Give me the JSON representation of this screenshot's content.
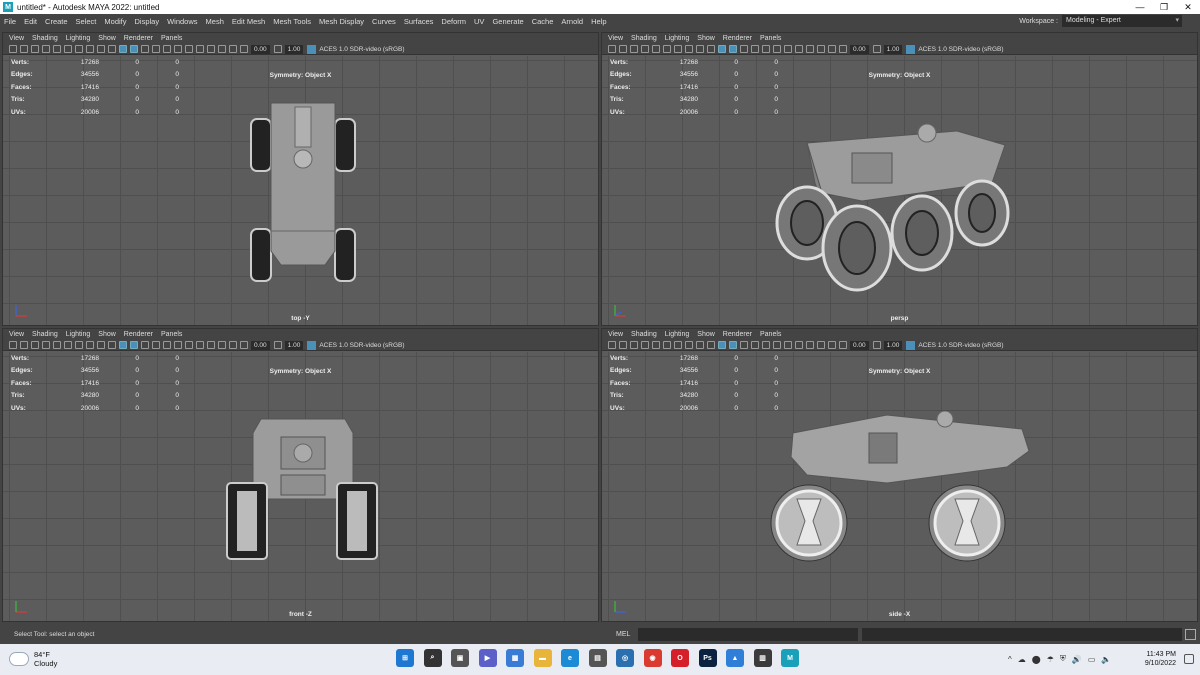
{
  "window": {
    "title": "untitled* - Autodesk MAYA 2022: untitled",
    "logo": "M",
    "controls": [
      "—",
      "❐",
      "✕"
    ]
  },
  "menu": [
    "File",
    "Edit",
    "Create",
    "Select",
    "Modify",
    "Display",
    "Windows",
    "Mesh",
    "Edit Mesh",
    "Mesh Tools",
    "Mesh Display",
    "Curves",
    "Surfaces",
    "Deform",
    "UV",
    "Generate",
    "Cache",
    "Arnold",
    "Help"
  ],
  "workspace": {
    "label": "Workspace :",
    "value": "Modeling - Expert"
  },
  "panel_menu": [
    "View",
    "Shading",
    "Lighting",
    "Show",
    "Renderer",
    "Panels"
  ],
  "toolbar": {
    "val1": "0.00",
    "val2": "1.00",
    "colorspace": "ACES 1.0 SDR-video (sRGB)"
  },
  "hud": {
    "rows": [
      {
        "k": "Verts:",
        "v": "17268",
        "a": "0",
        "b": "0"
      },
      {
        "k": "Edges:",
        "v": "34556",
        "a": "0",
        "b": "0"
      },
      {
        "k": "Faces:",
        "v": "17416",
        "a": "0",
        "b": "0"
      },
      {
        "k": "Tris:",
        "v": "34280",
        "a": "0",
        "b": "0"
      },
      {
        "k": "UVs:",
        "v": "20006",
        "a": "0",
        "b": "0"
      }
    ],
    "symmetry": "Symmetry: Object X"
  },
  "viewports": {
    "top": {
      "label": "top -Y"
    },
    "persp": {
      "label": "persp"
    },
    "front": {
      "label": "front -Z"
    },
    "side": {
      "label": "side -X"
    }
  },
  "cmdline": {
    "help": "Select Tool: select an object",
    "mel": "MEL"
  },
  "taskbar": {
    "weather_temp": "84°F",
    "weather_cond": "Cloudy",
    "time": "11:43 PM",
    "date": "9/10/2022",
    "tray": [
      "^",
      "☁",
      "⬤",
      "☂",
      "⛨",
      "🔊",
      "▭",
      "🔈"
    ],
    "apps": [
      {
        "name": "start",
        "label": "⊞",
        "color": "#1e78d2"
      },
      {
        "name": "search",
        "label": "⌕",
        "color": "#333333"
      },
      {
        "name": "task-view",
        "label": "▣",
        "color": "#555555"
      },
      {
        "name": "chat",
        "label": "▶",
        "color": "#5b5fc7"
      },
      {
        "name": "widgets",
        "label": "▦",
        "color": "#3a7bd5"
      },
      {
        "name": "file-explorer",
        "label": "▬",
        "color": "#e8b43a"
      },
      {
        "name": "edge",
        "label": "e",
        "color": "#1d8ad6"
      },
      {
        "name": "store",
        "label": "▤",
        "color": "#555555"
      },
      {
        "name": "settings-app",
        "label": "◎",
        "color": "#2a6fb0"
      },
      {
        "name": "chrome",
        "label": "◉",
        "color": "#d93b30"
      },
      {
        "name": "opera",
        "label": "O",
        "color": "#d5202a"
      },
      {
        "name": "photoshop",
        "label": "Ps",
        "color": "#0a2240"
      },
      {
        "name": "photos",
        "label": "▲",
        "color": "#2f7fd8"
      },
      {
        "name": "calculator",
        "label": "▥",
        "color": "#3b3b3b"
      },
      {
        "name": "maya",
        "label": "M",
        "color": "#1aa0b8"
      }
    ]
  }
}
